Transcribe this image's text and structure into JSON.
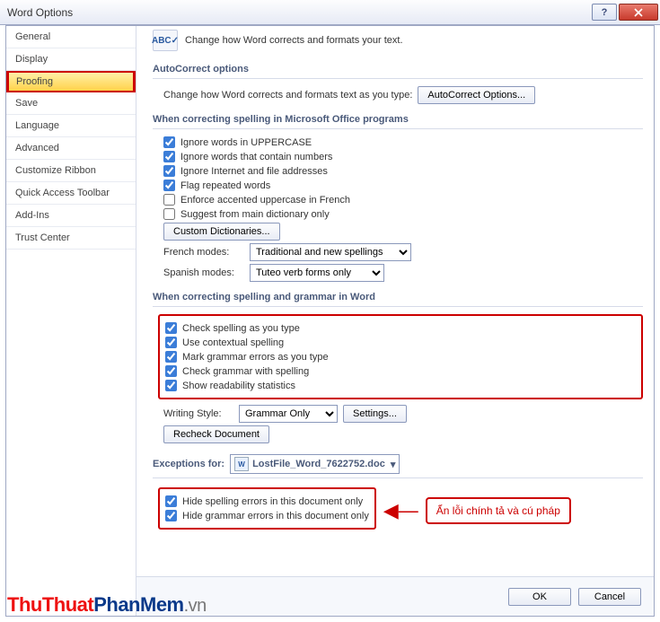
{
  "window": {
    "title": "Word Options"
  },
  "nav": {
    "items": [
      {
        "label": "General"
      },
      {
        "label": "Display"
      },
      {
        "label": "Proofing",
        "selected": true
      },
      {
        "label": "Save"
      },
      {
        "label": "Language"
      },
      {
        "label": "Advanced"
      },
      {
        "label": "Customize Ribbon"
      },
      {
        "label": "Quick Access Toolbar"
      },
      {
        "label": "Add-Ins"
      },
      {
        "label": "Trust Center"
      }
    ]
  },
  "intro": {
    "icon_text": "ABC✓",
    "text": "Change how Word corrects and formats your text."
  },
  "autocorrect": {
    "heading": "AutoCorrect options",
    "text": "Change how Word corrects and formats text as you type:",
    "button": "AutoCorrect Options..."
  },
  "office_spelling": {
    "heading": "When correcting spelling in Microsoft Office programs",
    "items": [
      {
        "label": "Ignore words in UPPERCASE",
        "checked": true
      },
      {
        "label": "Ignore words that contain numbers",
        "checked": true
      },
      {
        "label": "Ignore Internet and file addresses",
        "checked": true
      },
      {
        "label": "Flag repeated words",
        "checked": true
      },
      {
        "label": "Enforce accented uppercase in French",
        "checked": false
      },
      {
        "label": "Suggest from main dictionary only",
        "checked": false
      }
    ],
    "custom_dict_btn": "Custom Dictionaries...",
    "french_label": "French modes:",
    "french_value": "Traditional and new spellings",
    "spanish_label": "Spanish modes:",
    "spanish_value": "Tuteo verb forms only"
  },
  "word_spelling": {
    "heading": "When correcting spelling and grammar in Word",
    "items": [
      {
        "label": "Check spelling as you type",
        "checked": true
      },
      {
        "label": "Use contextual spelling",
        "checked": true
      },
      {
        "label": "Mark grammar errors as you type",
        "checked": true
      },
      {
        "label": "Check grammar with spelling",
        "checked": true
      },
      {
        "label": "Show readability statistics",
        "checked": true
      }
    ],
    "writing_style_label": "Writing Style:",
    "writing_style_value": "Grammar Only",
    "settings_btn": "Settings...",
    "recheck_btn": "Recheck Document"
  },
  "exceptions": {
    "heading": "Exceptions for:",
    "doc_name": "LostFile_Word_7622752.doc",
    "items": [
      {
        "label": "Hide spelling errors in this document only",
        "checked": true
      },
      {
        "label": "Hide grammar errors in this document only",
        "checked": true
      }
    ]
  },
  "callout": {
    "arrow": "◀—",
    "text": "Ẩn lỗi chính tả và cú pháp"
  },
  "footer": {
    "ok": "OK",
    "cancel": "Cancel"
  },
  "watermark": {
    "part1": "ThuThuat",
    "part2": "PhanMem",
    "part3": ".vn"
  }
}
